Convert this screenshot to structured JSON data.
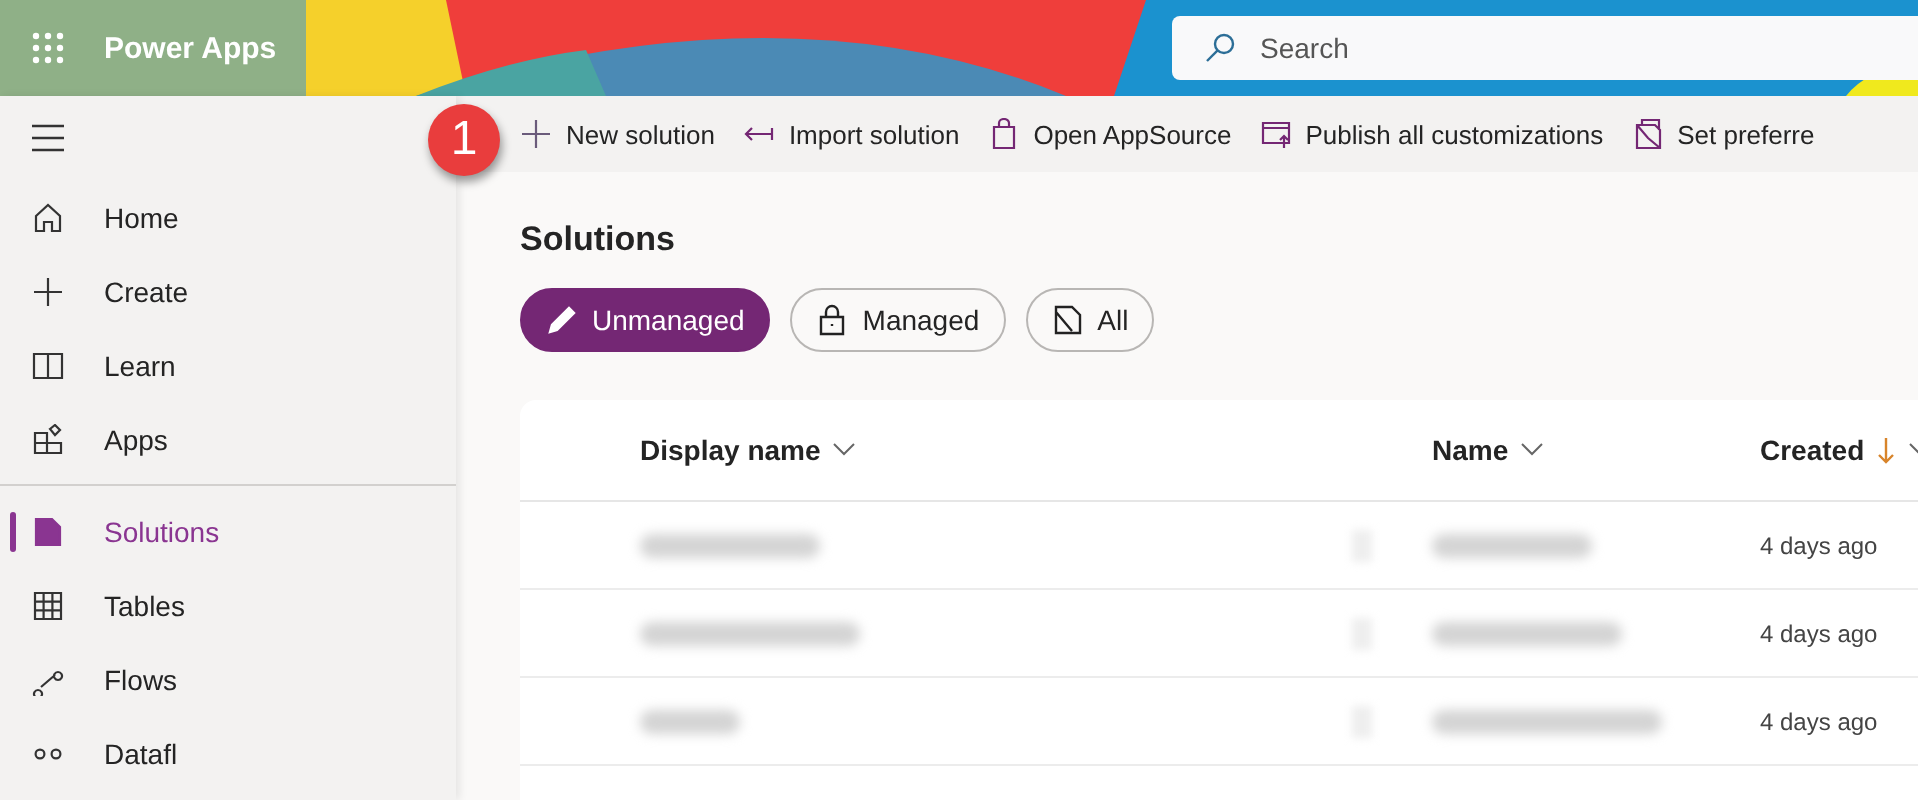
{
  "header": {
    "app_name": "Power Apps",
    "search": {
      "placeholder": "Search"
    }
  },
  "toolbar": {
    "step_badge": "1",
    "actions": [
      {
        "kind": "plus",
        "label": "New solution"
      },
      {
        "kind": "import",
        "label": "Import solution"
      },
      {
        "kind": "bag",
        "label": "Open AppSource"
      },
      {
        "kind": "publish",
        "label": "Publish all customizations"
      },
      {
        "kind": "preferred",
        "label": "Set preferre"
      }
    ]
  },
  "sidebar": {
    "items": [
      {
        "kind": "home",
        "label": "Home",
        "selected": false
      },
      {
        "kind": "plus",
        "label": "Create",
        "selected": false
      },
      {
        "kind": "book",
        "label": "Learn",
        "selected": false
      },
      {
        "kind": "apps",
        "label": "Apps",
        "selected": false
      },
      {
        "kind": "divider"
      },
      {
        "kind": "solutions",
        "label": "Solutions",
        "selected": true
      },
      {
        "kind": "table",
        "label": "Tables",
        "selected": false
      },
      {
        "kind": "flow",
        "label": "Flows",
        "selected": false
      },
      {
        "kind": "dataflow",
        "label": "Datafl",
        "selected": false
      }
    ]
  },
  "page": {
    "title": "Solutions",
    "filters": [
      {
        "kind": "pencil",
        "label": "Unmanaged",
        "selected": true
      },
      {
        "kind": "lock",
        "label": "Managed",
        "selected": false
      },
      {
        "kind": "folder",
        "label": "All",
        "selected": false
      }
    ]
  },
  "table": {
    "columns": [
      {
        "label": "Display name",
        "sorted": false
      },
      {
        "label": "Name",
        "sorted": false
      },
      {
        "label": "Created",
        "sorted": true
      }
    ],
    "rows": [
      {
        "created": "4 days ago"
      },
      {
        "created": "4 days ago"
      },
      {
        "created": "4 days ago"
      }
    ]
  }
}
